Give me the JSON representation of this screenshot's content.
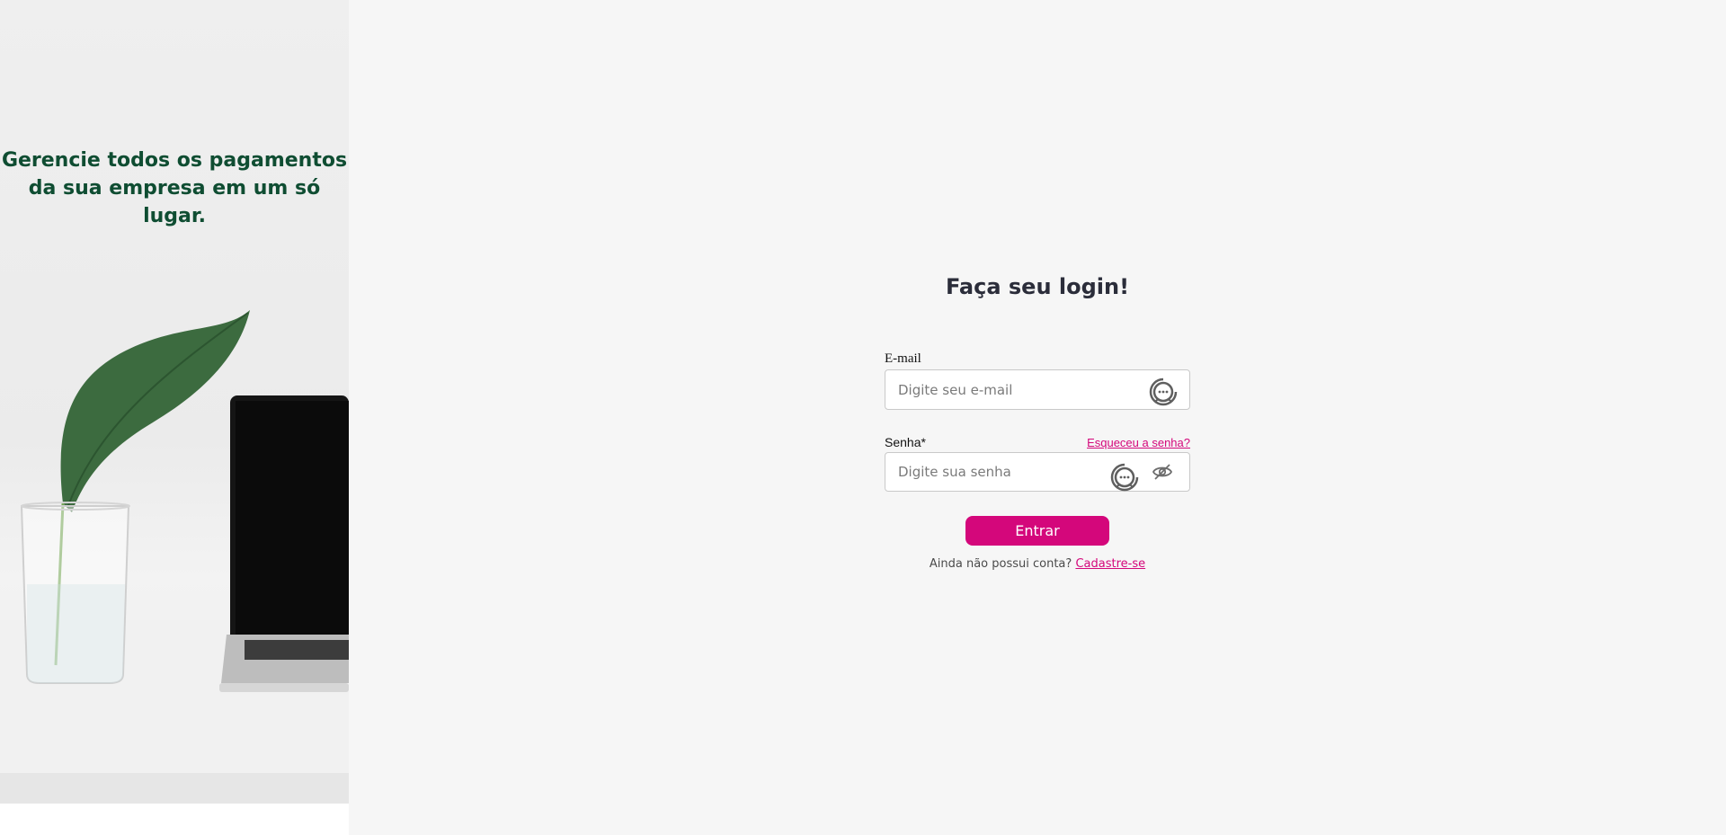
{
  "hero": {
    "headline": "Gerencie todos os pagamentos da sua empresa em um só lugar."
  },
  "login": {
    "title": "Faça seu login!",
    "email_label": "E-mail",
    "email_placeholder": "Digite seu e-mail",
    "email_value": "",
    "password_label": "Senha*",
    "password_placeholder": "Digite sua senha",
    "password_value": "",
    "forgot_label": "Esqueceu a senha?",
    "submit_label": "Entrar",
    "signup_prompt": "Ainda não possui conta?",
    "signup_link": "Cadastre-se"
  },
  "icons": {
    "field_extension": "chat-bubble-icon",
    "password_toggle": "eye-off-icon"
  },
  "colors": {
    "accent": "#d4077b",
    "headline": "#0f4d32",
    "title": "#2b2d3a",
    "background": "#f6f6f6"
  }
}
